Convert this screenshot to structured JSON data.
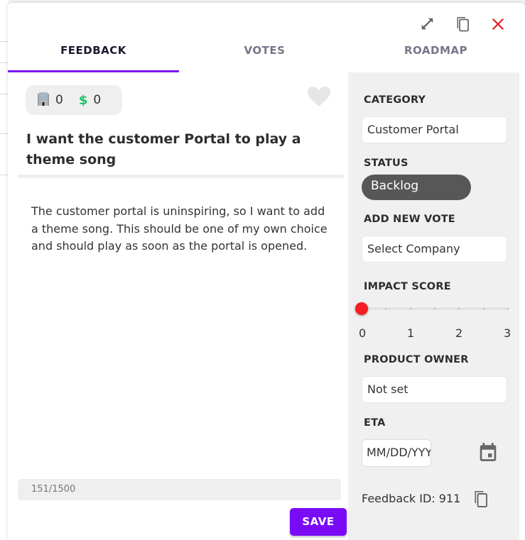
{
  "window": {
    "actions": [
      {
        "name": "expand-icon",
        "label": "Expand"
      },
      {
        "name": "copy-icon",
        "label": "Copy"
      },
      {
        "name": "close-icon",
        "label": "Close"
      }
    ]
  },
  "tabs": [
    {
      "label": "FEEDBACK",
      "active": true
    },
    {
      "label": "VOTES",
      "active": false
    },
    {
      "label": "ROADMAP",
      "active": false
    }
  ],
  "feedback": {
    "company_votes": "0",
    "revenue_votes": "0",
    "title": "I want the customer Portal to play a theme song",
    "description": "The customer portal is uninspiring, so I want to add a theme song. This should be one of my own choice and should play as soon as the portal is opened.",
    "char_counter": "151/1500",
    "save_label": "SAVE"
  },
  "sidebar": {
    "category_label": "CATEGORY",
    "category_value": "Customer Portal",
    "status_label": "STATUS",
    "status_value": "Backlog",
    "add_vote_label": "ADD NEW VOTE",
    "add_vote_placeholder": "Select Company",
    "impact_label": "IMPACT SCORE",
    "impact_value": 0,
    "impact_scale": [
      "0",
      "1",
      "2",
      "3"
    ],
    "owner_label": "PRODUCT OWNER",
    "owner_value": "Not set",
    "eta_label": "ETA",
    "eta_placeholder": "MM/DD/YYYY",
    "feedback_id_text": "Feedback ID: 911"
  },
  "colors": {
    "accent": "#7e16f5",
    "save_button": "#7a0bf7",
    "close_red": "#e0262b",
    "slider_thumb": "#f51d24",
    "status_bg": "#575757",
    "dollar_green": "#1fc46a"
  }
}
